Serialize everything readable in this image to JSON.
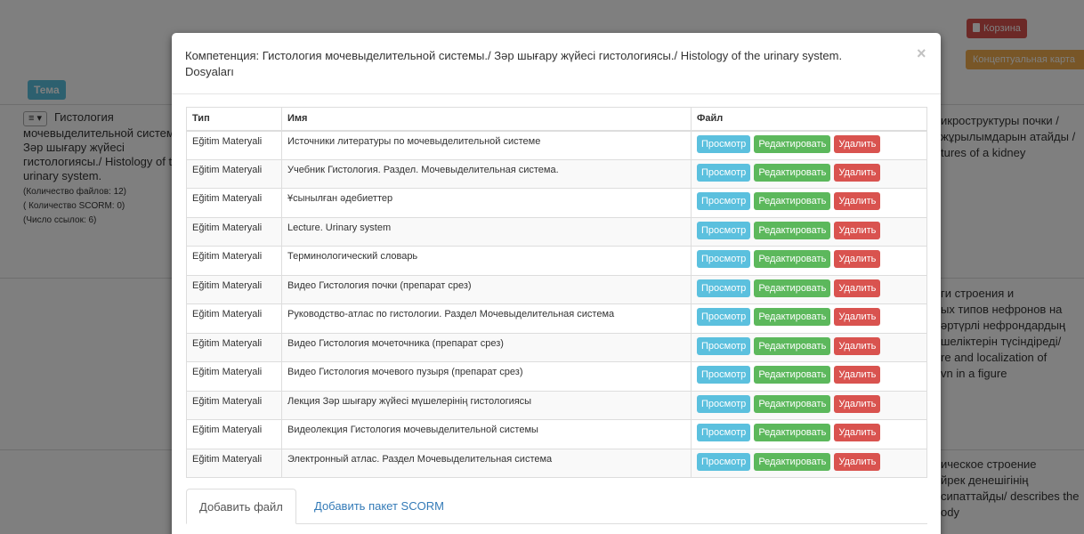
{
  "background": {
    "cart_button": "Корзина",
    "concept_map_button": "Концептуальная карта",
    "theme_label": "Тема",
    "topic": {
      "title": "Гистология мочевыделительной системы./ Зәр шығару жүйесі гистологиясы./ Histology of the urinary system.",
      "files_count": "(Количество файлов: 12)",
      "scorm_count": "( Количество SCORM: 0)",
      "links_count": "(Число ссылок: 6)"
    },
    "right_texts": [
      "икроструктуры почки /\nжұрылымдарын атайды /\ntures of a kidney",
      "ги строения и\nых типов нефронов на\nəртүрлі нефрондардың\nшеліктерін түсіндіреді/\nre and localization of\nvn in a figure",
      "ическое строение\nйрек денешігінің\nсипаттайды/ describes the\nody"
    ]
  },
  "modal": {
    "title": "Компетенция: Гистология мочевыделительной системы./ Зәр шығару жүйесі гистологиясы./ Histology of the urinary system. Dosyaları",
    "close": "×",
    "table": {
      "headers": [
        "Тип",
        "Имя",
        "Файл"
      ],
      "rows": [
        {
          "type": "Eğitim Materyali",
          "name": "Источники литературы по мочевыделительной системе"
        },
        {
          "type": "Eğitim Materyali",
          "name": "Учебник Гистология. Раздел. Мочевыделительная система."
        },
        {
          "type": "Eğitim Materyali",
          "name": "Ұсынылған әдебиеттер"
        },
        {
          "type": "Eğitim Materyali",
          "name": "Lecture. Urinary system"
        },
        {
          "type": "Eğitim Materyali",
          "name": "Терминологический словарь"
        },
        {
          "type": "Eğitim Materyali",
          "name": "Видео Гистология почки (препарат срез)"
        },
        {
          "type": "Eğitim Materyali",
          "name": "Руководство-атлас по гистологии. Раздел Мочевыделительная система"
        },
        {
          "type": "Eğitim Materyali",
          "name": "Видео Гистология мочеточника (препарат срез)"
        },
        {
          "type": "Eğitim Materyali",
          "name": "Видео Гистология мочевого пузыря (препарат срез)"
        },
        {
          "type": "Eğitim Materyali",
          "name": "Лекция Зәр шығару жүйесі мүшелерінің гистологиясы"
        },
        {
          "type": "Eğitim Materyali",
          "name": "Видеолекция Гистология мочевыделительной системы"
        },
        {
          "type": "Eğitim Materyali",
          "name": "Электронный атлас. Раздел Мочевыделительная система"
        }
      ],
      "actions": {
        "view": "Просмотр",
        "edit": "Редактировать",
        "delete": "Удалить"
      }
    },
    "tabs": [
      "Добавить файл",
      "Добавить пакет SCORM"
    ]
  }
}
